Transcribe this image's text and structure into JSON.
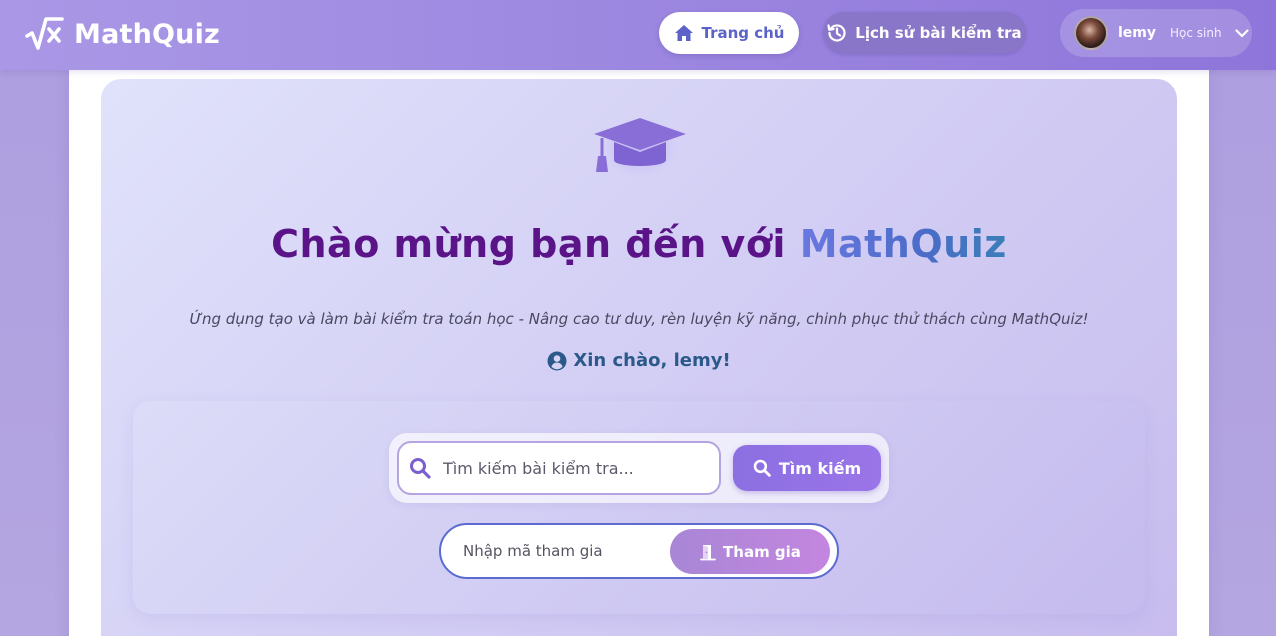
{
  "app": {
    "logo_text": "MathQuiz",
    "logo_icon": "square-root-x-icon"
  },
  "nav": {
    "home_label": "Trang chủ",
    "home_icon": "house-icon",
    "history_label": "Lịch sử bài kiểm tra",
    "history_icon": "history-clock-icon"
  },
  "user": {
    "name": "lemy",
    "role": "Học sinh",
    "menu_icon": "chevron-down-icon"
  },
  "hero": {
    "icon": "graduation-cap-icon",
    "title_prefix": "Chào mừng bạn đến với ",
    "title_brand": "MathQuiz",
    "subtitle": "Ứng dụng tạo và làm bài kiểm tra toán học - Nâng cao tư duy, rèn luyện kỹ năng, chinh phục thử thách cùng MathQuiz!",
    "greeting": "Xin chào, lemy!",
    "greeting_icon": "user-circle-icon"
  },
  "search": {
    "placeholder": "Tìm kiếm bài kiểm tra...",
    "value": "",
    "button_label": "Tìm kiếm",
    "icon": "search-icon"
  },
  "join": {
    "placeholder": "Nhập mã tham gia",
    "value": "",
    "button_label": "Tham gia",
    "icon": "door-open-icon"
  },
  "colors": {
    "header_start": "#aa98e6",
    "header_end": "#8e75da",
    "title": "#5a1488",
    "brand_accent": "#5a72d4",
    "greeting": "#2b5a8a",
    "search_button": "#8c6fe2",
    "join_button": "#b886dc"
  }
}
